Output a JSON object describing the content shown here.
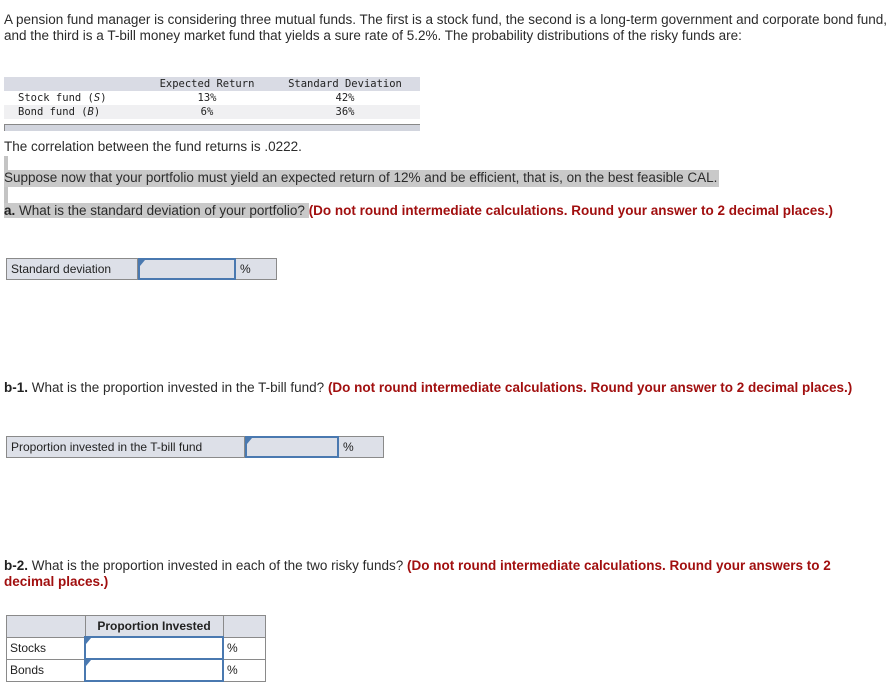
{
  "intro": "A pension fund manager is considering three mutual funds. The first is a stock fund, the second is a long-term government and corporate bond fund, and the third is a T-bill money market fund that yields a sure rate of 5.2%. The probability distributions of the risky funds are:",
  "fund_table": {
    "headers": [
      "",
      "Expected Return",
      "Standard Deviation"
    ],
    "rows": [
      {
        "name": "Stock fund (",
        "symbol": "S",
        "close": ")",
        "expected_return": "13%",
        "std_dev": "42%"
      },
      {
        "name": "Bond fund (",
        "symbol": "B",
        "close": ")",
        "expected_return": "6%",
        "std_dev": "36%"
      }
    ]
  },
  "correlation_text": "The correlation between the fund returns is .0222.",
  "suppose_text": "Suppose now that your portfolio must yield an expected return of 12% and be efficient, that is, on the best feasible CAL.",
  "question_a": {
    "label": "a.",
    "text": " What is the standard deviation of your portfolio? ",
    "instruction": "(Do not round intermediate calculations. Round your answer to 2 decimal places.)",
    "field_label": "Standard deviation",
    "field_value": "",
    "unit": "%"
  },
  "question_b1": {
    "label": "b-1.",
    "text": " What is the proportion invested in the T-bill fund? ",
    "instruction": "(Do not round intermediate calculations. Round your answer to 2 decimal places.)",
    "field_label": "Proportion invested in the T-bill fund",
    "field_value": "",
    "unit": "%"
  },
  "question_b2": {
    "label": "b-2.",
    "text": " What is the proportion invested in each of the two risky funds? ",
    "instruction": "(Do not round intermediate calculations. Round your answers to 2 decimal places.)",
    "table_header": "Proportion Invested",
    "rows": [
      {
        "label": "Stocks",
        "value": "",
        "unit": "%"
      },
      {
        "label": "Bonds",
        "value": "",
        "unit": "%"
      }
    ]
  },
  "colors": {
    "instruction_red": "#a10f0f",
    "input_border": "#4a79b0",
    "highlight": "#c9c9c9",
    "table_header_bg": "#dde0e8"
  }
}
